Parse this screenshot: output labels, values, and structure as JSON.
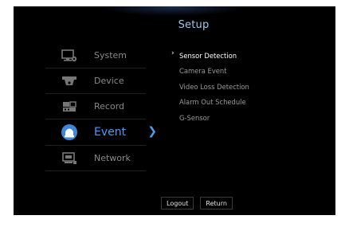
{
  "title": "Setup",
  "menu": [
    {
      "label": "System",
      "icon": "system-icon",
      "active": false
    },
    {
      "label": "Device",
      "icon": "device-icon",
      "active": false
    },
    {
      "label": "Record",
      "icon": "record-icon",
      "active": false
    },
    {
      "label": "Event",
      "icon": "event-icon",
      "active": true
    },
    {
      "label": "Network",
      "icon": "network-icon",
      "active": false
    }
  ],
  "submenu": [
    {
      "label": "Sensor Detection",
      "selected": true
    },
    {
      "label": "Camera Event",
      "selected": false
    },
    {
      "label": "Video Loss Detection",
      "selected": false
    },
    {
      "label": "Alarm Out Schedule",
      "selected": false
    },
    {
      "label": "G-Sensor",
      "selected": false
    }
  ],
  "buttons": {
    "logout": "Logout",
    "return": "Return"
  },
  "colors": {
    "accent": "#4b9bf2",
    "title": "#9fc6ee",
    "inactive": "#8a8a8a",
    "background": "#000000"
  }
}
